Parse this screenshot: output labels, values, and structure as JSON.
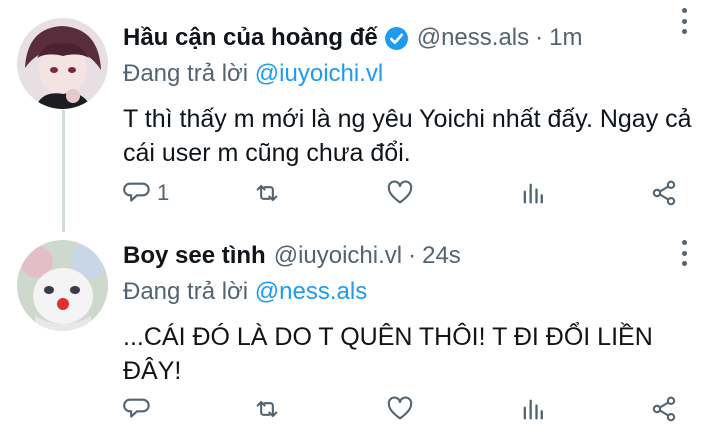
{
  "colors": {
    "accent": "#1d9bf0",
    "secondary_text": "#536471",
    "thread_line": "#cfd9de"
  },
  "tweets": [
    {
      "avatar_icon": "user-avatar-icon",
      "display_name": "Hầu cận của hoàng đế",
      "verified": true,
      "handle": "@ness.als",
      "separator": "·",
      "time": "1m",
      "reply_prefix": "Đang trả lời",
      "reply_to": "@iuyoichi.vl",
      "text": "T thì thấy m mới là ng yêu Yoichi nhất đấy. Ngay cả cái user m cũng chưa đổi.",
      "reply_count": "1"
    },
    {
      "avatar_icon": "user-avatar-icon",
      "display_name": "Boy see tình",
      "verified": false,
      "handle": "@iuyoichi.vl",
      "separator": "·",
      "time": "24s",
      "reply_prefix": "Đang trả lời",
      "reply_to": "@ness.als",
      "text": "...CÁI ĐÓ LÀ DO T QUÊN THÔI! T ĐI ĐỔI LIỀN ĐÂY!",
      "reply_count": ""
    }
  ]
}
